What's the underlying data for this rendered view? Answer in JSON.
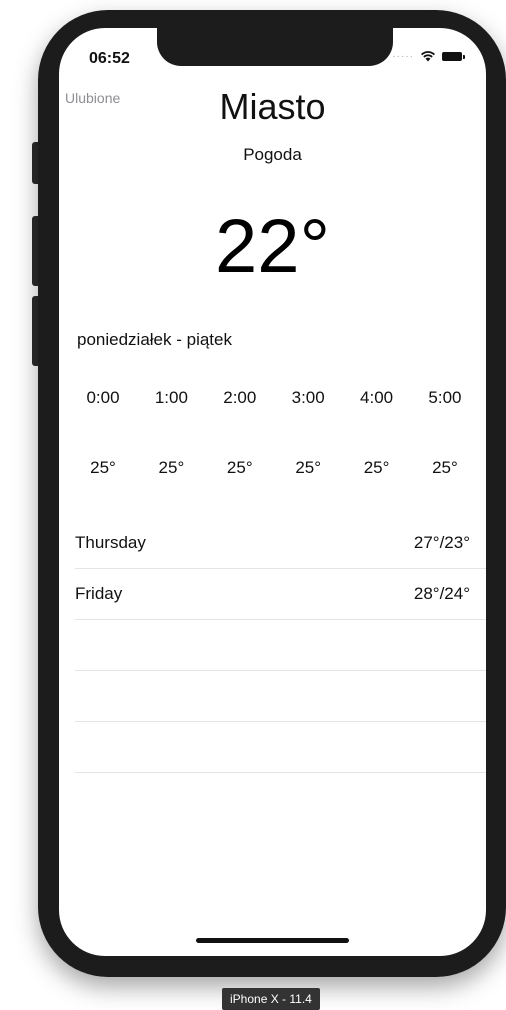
{
  "status_bar": {
    "time": "06:52",
    "signal_icon": "signal-dots-icon",
    "wifi_icon": "wifi-icon",
    "battery_icon": "battery-icon"
  },
  "nav": {
    "favorites_label": "Ulubione"
  },
  "header": {
    "city": "Miasto",
    "condition": "Pogoda",
    "temperature": "22°"
  },
  "hourly": {
    "range_label": "poniedziałek - piątek",
    "hours": [
      "0:00",
      "1:00",
      "2:00",
      "3:00",
      "4:00",
      "5:00"
    ],
    "temps": [
      "25°",
      "25°",
      "25°",
      "25°",
      "25°",
      "25°"
    ]
  },
  "daily": [
    {
      "day": "Thursday",
      "range": "27°/23°"
    },
    {
      "day": "Friday",
      "range": "28°/24°"
    },
    {
      "day": "",
      "range": ""
    },
    {
      "day": "",
      "range": ""
    },
    {
      "day": "",
      "range": ""
    }
  ],
  "simulator": {
    "device_label": "iPhone X - 11.4"
  }
}
